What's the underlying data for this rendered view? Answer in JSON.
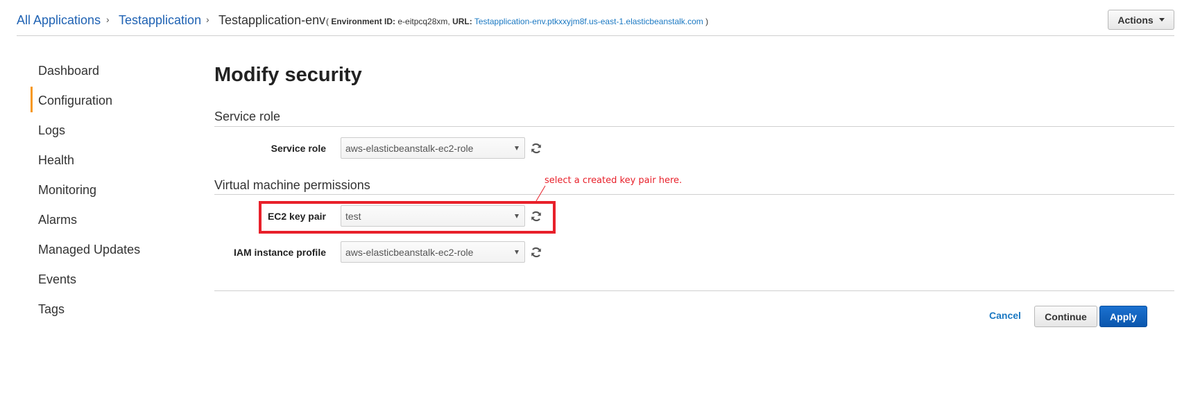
{
  "breadcrumb": {
    "items": [
      {
        "label": "All Applications",
        "link": true
      },
      {
        "label": "Testapplication",
        "link": true
      },
      {
        "label": "Testapplication-env",
        "link": false
      }
    ],
    "separator": "›",
    "env_info": {
      "open": "(",
      "env_id_label": "Environment ID:",
      "env_id": "e-eitpcq28xm,",
      "url_label": "URL:",
      "url": "Testapplication-env.ptkxxyjm8f.us-east-1.elasticbeanstalk.com",
      "close": ")"
    }
  },
  "actions_button": {
    "label": "Actions"
  },
  "sidebar": {
    "items": [
      {
        "label": "Dashboard",
        "active": false
      },
      {
        "label": "Configuration",
        "active": true
      },
      {
        "label": "Logs",
        "active": false
      },
      {
        "label": "Health",
        "active": false
      },
      {
        "label": "Monitoring",
        "active": false
      },
      {
        "label": "Alarms",
        "active": false
      },
      {
        "label": "Managed Updates",
        "active": false
      },
      {
        "label": "Events",
        "active": false
      },
      {
        "label": "Tags",
        "active": false
      }
    ],
    "active_color": "#f7981c"
  },
  "main": {
    "title": "Modify security",
    "sections": [
      {
        "title": "Service role",
        "fields": [
          {
            "label": "Service role",
            "value": "aws-elasticbeanstalk-ec2-role",
            "icon": "refresh-icon"
          }
        ]
      },
      {
        "title": "Virtual machine permissions",
        "fields": [
          {
            "label": "EC2 key pair",
            "value": "test",
            "icon": "refresh-icon"
          },
          {
            "label": "IAM instance profile",
            "value": "aws-elasticbeanstalk-ec2-role",
            "icon": "refresh-icon"
          }
        ]
      }
    ],
    "annotation": {
      "text": "select a created key pair here.",
      "color": "#e8202a"
    }
  },
  "footer": {
    "cancel_label": "Cancel",
    "continue_label": "Continue",
    "apply_label": "Apply"
  }
}
